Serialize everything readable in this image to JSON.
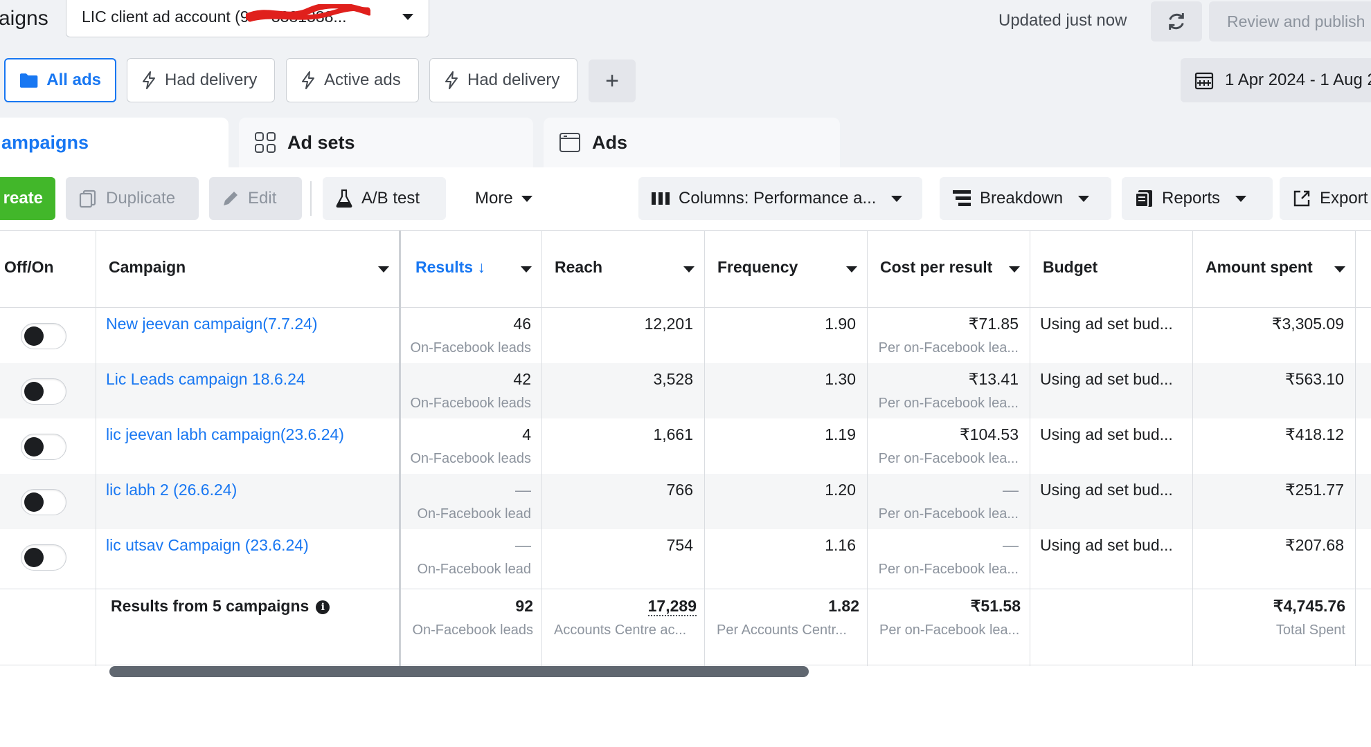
{
  "header": {
    "page_title": "aigns",
    "account_label": "LIC client ad account (9       3381338...",
    "updated_text": "Updated just now",
    "review_label": "Review and publish"
  },
  "filters": {
    "chips": [
      {
        "label": "All ads",
        "icon": "folder-icon"
      },
      {
        "label": "Had delivery",
        "icon": "lightning-icon"
      },
      {
        "label": "Active ads",
        "icon": "lightning-icon"
      },
      {
        "label": "Had delivery",
        "icon": "lightning-icon"
      }
    ],
    "add_label": "+",
    "date_range": "1 Apr 2024 - 1 Aug 2"
  },
  "levels": {
    "campaigns": "ampaigns",
    "ad_sets": "Ad sets",
    "ads": "Ads"
  },
  "toolbar": {
    "create": "reate",
    "duplicate": "Duplicate",
    "edit": "Edit",
    "ab_test": "A/B test",
    "more": "More",
    "columns": "Columns: Performance a...",
    "breakdown": "Breakdown",
    "reports": "Reports",
    "export": "Export"
  },
  "table": {
    "headers": {
      "off_on": "Off/On",
      "campaign": "Campaign",
      "results": "Results ↓",
      "reach": "Reach",
      "frequency": "Frequency",
      "cost_per_result": "Cost per result",
      "budget": "Budget",
      "amount_spent": "Amount spent"
    },
    "rows": [
      {
        "campaign": "New jeevan campaign(7.7.24)",
        "results": "46",
        "results_sub": "On-Facebook leads",
        "reach": "12,201",
        "frequency": "1.90",
        "cpr": "₹71.85",
        "cpr_sub": "Per on-Facebook lea...",
        "budget": "Using ad set bud...",
        "spent": "₹3,305.09",
        "on": false
      },
      {
        "campaign": "Lic Leads campaign 18.6.24",
        "results": "42",
        "results_sub": "On-Facebook leads",
        "reach": "3,528",
        "frequency": "1.30",
        "cpr": "₹13.41",
        "cpr_sub": "Per on-Facebook lea...",
        "budget": "Using ad set bud...",
        "spent": "₹563.10",
        "on": false
      },
      {
        "campaign": "lic jeevan labh campaign(23.6.24)",
        "results": "4",
        "results_sub": "On-Facebook leads",
        "reach": "1,661",
        "frequency": "1.19",
        "cpr": "₹104.53",
        "cpr_sub": "Per on-Facebook lea...",
        "budget": "Using ad set bud...",
        "spent": "₹418.12",
        "on": false
      },
      {
        "campaign": "lic labh 2 (26.6.24)",
        "results": "—",
        "results_sub": "On-Facebook lead",
        "reach": "766",
        "frequency": "1.20",
        "cpr": "—",
        "cpr_sub": "Per on-Facebook lea...",
        "budget": "Using ad set bud...",
        "spent": "₹251.77",
        "on": false
      },
      {
        "campaign": "lic utsav Campaign (23.6.24)",
        "results": "—",
        "results_sub": "On-Facebook lead",
        "reach": "754",
        "frequency": "1.16",
        "cpr": "—",
        "cpr_sub": "Per on-Facebook lea...",
        "budget": "Using ad set bud...",
        "spent": "₹207.68",
        "on": false
      }
    ],
    "summary": {
      "label": "Results from 5 campaigns",
      "results": "92",
      "results_sub": "On-Facebook leads",
      "reach": "17,289",
      "reach_sub": "Accounts Centre ac...",
      "frequency": "1.82",
      "frequency_sub": "Per Accounts Centr...",
      "cpr": "₹51.58",
      "cpr_sub": "Per on-Facebook lea...",
      "spent": "₹4,745.76",
      "spent_sub": "Total Spent"
    }
  },
  "colors": {
    "accent": "#1877f2",
    "create_green": "#42b72a",
    "redaction": "#e0201c"
  }
}
